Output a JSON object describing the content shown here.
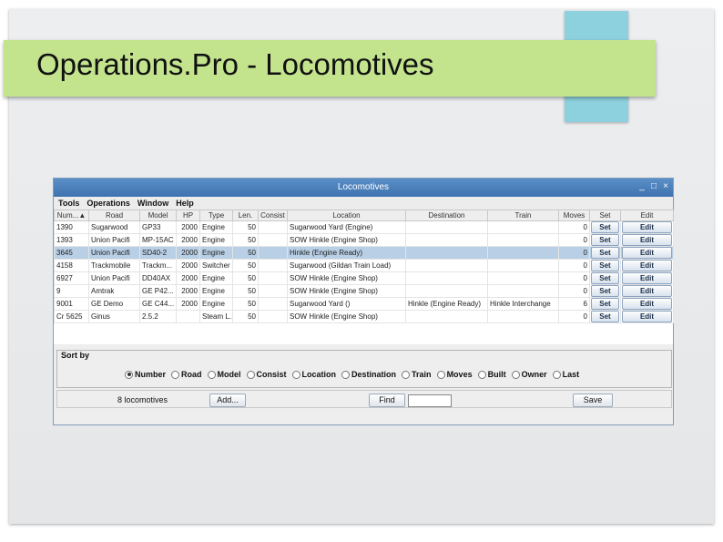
{
  "slide": {
    "title": "Operations.Pro - Locomotives",
    "colors": {
      "banner": "#c3e38d",
      "accent": "#8ed1de"
    }
  },
  "window": {
    "title": "Locomotives",
    "controls": {
      "minimize": "_",
      "maximize": "□",
      "close": "×"
    },
    "menu": [
      "Tools",
      "Operations",
      "Window",
      "Help"
    ],
    "table": {
      "columns": [
        "Num...",
        "Road",
        "Model",
        "HP",
        "Type",
        "Len.",
        "Consist",
        "Location",
        "Destination",
        "Train",
        "Moves",
        "Set",
        "Edit"
      ],
      "sort_arrow": "▲",
      "rows": [
        {
          "num": "1390",
          "road": "Sugarwood",
          "model": "GP33",
          "hp": "2000",
          "type": "Engine",
          "len": "50",
          "consist": "",
          "location": "Sugarwood Yard (Engine)",
          "destination": "",
          "train": "",
          "moves": "0",
          "set": "Set",
          "edit": "Edit",
          "selected": false
        },
        {
          "num": "1393",
          "road": "Union Pacifi",
          "model": "MP-15AC",
          "hp": "2000",
          "type": "Engine",
          "len": "50",
          "consist": "",
          "location": "SOW Hinkle (Engine Shop)",
          "destination": "",
          "train": "",
          "moves": "0",
          "set": "Set",
          "edit": "Edit",
          "selected": false
        },
        {
          "num": "3645",
          "road": "Union Pacifi",
          "model": "SD40-2",
          "hp": "2000",
          "type": "Engine",
          "len": "50",
          "consist": "",
          "location": "Hinkle (Engine Ready)",
          "destination": "",
          "train": "",
          "moves": "0",
          "set": "Set",
          "edit": "Edit",
          "selected": true
        },
        {
          "num": "4158",
          "road": "Trackmobile",
          "model": "Trackm...",
          "hp": "2000",
          "type": "Switcher",
          "len": "50",
          "consist": "",
          "location": "Sugarwood (Gildan Train Load)",
          "destination": "",
          "train": "",
          "moves": "0",
          "set": "Set",
          "edit": "Edit",
          "selected": false
        },
        {
          "num": "6927",
          "road": "Union Pacifi",
          "model": "DD40AX",
          "hp": "2000",
          "type": "Engine",
          "len": "50",
          "consist": "",
          "location": "SOW Hinkle (Engine Shop)",
          "destination": "",
          "train": "",
          "moves": "0",
          "set": "Set",
          "edit": "Edit",
          "selected": false
        },
        {
          "num": "9",
          "road": "Amtrak",
          "model": "GE P42...",
          "hp": "2000",
          "type": "Engine",
          "len": "50",
          "consist": "",
          "location": "SOW Hinkle (Engine Shop)",
          "destination": "",
          "train": "",
          "moves": "0",
          "set": "Set",
          "edit": "Edit",
          "selected": false
        },
        {
          "num": "9001",
          "road": "GE Demo",
          "model": "GE C44...",
          "hp": "2000",
          "type": "Engine",
          "len": "50",
          "consist": "",
          "location": "Sugarwood Yard ()",
          "destination": "Hinkle (Engine Ready)",
          "train": "Hinkle Interchange",
          "moves": "6",
          "set": "Set",
          "edit": "Edit",
          "selected": false
        },
        {
          "num": "Cr 5625",
          "road": "Ginus",
          "model": "2.5.2",
          "hp": "",
          "type": "Steam L...",
          "len": "50",
          "consist": "",
          "location": "SOW Hinkle (Engine Shop)",
          "destination": "",
          "train": "",
          "moves": "0",
          "set": "Set",
          "edit": "Edit",
          "selected": false
        }
      ]
    },
    "sort": {
      "label": "Sort by",
      "options": [
        "Number",
        "Road",
        "Model",
        "Consist",
        "Location",
        "Destination",
        "Train",
        "Moves",
        "Built",
        "Owner",
        "Last"
      ],
      "selected": "Number"
    },
    "footer": {
      "count": "8 locomotives",
      "add": "Add...",
      "find": "Find",
      "find_value": "",
      "save": "Save"
    }
  }
}
